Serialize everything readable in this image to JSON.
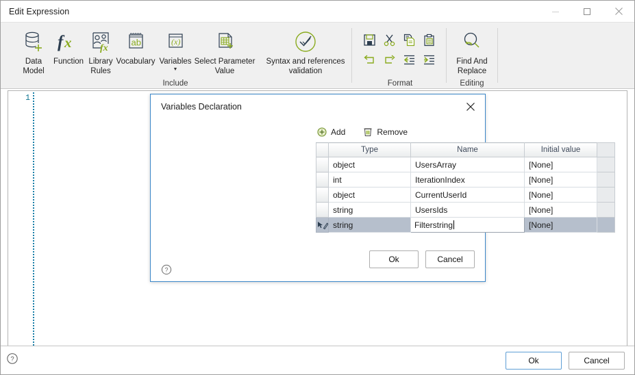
{
  "window": {
    "title": "Edit Expression",
    "minimize_label": "Minimize",
    "maximize_label": "Maximize",
    "close_label": "Close"
  },
  "ribbon": {
    "groups": [
      {
        "name": "include",
        "label": "Include",
        "items": [
          {
            "icon": "data-model-icon",
            "label": "Data\nModel",
            "caret": ""
          },
          {
            "icon": "function-fx-icon",
            "label": "Function",
            "caret": ""
          },
          {
            "icon": "library-rules-icon",
            "label": "Library\nRules",
            "caret": ""
          },
          {
            "icon": "vocabulary-icon",
            "label": "Vocabulary",
            "caret": ""
          },
          {
            "icon": "variables-icon",
            "label": "Variables",
            "caret": "▼"
          },
          {
            "icon": "select-parameter-value-icon",
            "label": "Select Parameter\nValue",
            "caret": ""
          }
        ]
      },
      {
        "name": "validation",
        "label": "",
        "items": [
          {
            "icon": "syntax-validation-check-icon",
            "label": "Syntax and references\nvalidation",
            "caret": ""
          }
        ]
      },
      {
        "name": "format",
        "label": "Format",
        "items": [
          {
            "icon": "save-icon",
            "label": "Save"
          },
          {
            "icon": "cut-scissors-icon",
            "label": "Cut"
          },
          {
            "icon": "copy-icon",
            "label": "Copy"
          },
          {
            "icon": "paste-clipboard-icon",
            "label": "Paste"
          },
          {
            "icon": "undo-arrow-icon",
            "label": "Undo"
          },
          {
            "icon": "redo-arrow-icon",
            "label": "Redo"
          },
          {
            "icon": "outdent-icon",
            "label": "Outdent"
          },
          {
            "icon": "indent-icon",
            "label": "Indent"
          }
        ]
      },
      {
        "name": "editing",
        "label": "Editing",
        "items": [
          {
            "icon": "find-and-replace-icon",
            "label": "Find And\nReplace",
            "caret": ""
          }
        ]
      }
    ]
  },
  "editor": {
    "line_numbers": [
      "1"
    ],
    "content": ""
  },
  "footer": {
    "help_icon": "help-question-icon",
    "ok_label": "Ok",
    "cancel_label": "Cancel"
  },
  "dialog": {
    "title": "Variables Declaration",
    "close_icon": "close-icon",
    "add_label": "Add",
    "add_icon": "plus-circle-icon",
    "remove_label": "Remove",
    "remove_icon": "trash-icon",
    "columns": [
      "Type",
      "Name",
      "Initial value"
    ],
    "rows": [
      {
        "type": "object",
        "name": "UsersArray",
        "initial": "[None]",
        "selected": false,
        "editing": false
      },
      {
        "type": "int",
        "name": "IterationIndex",
        "initial": "[None]",
        "selected": false,
        "editing": false
      },
      {
        "type": "object",
        "name": "CurrentUserId",
        "initial": "[None]",
        "selected": false,
        "editing": false
      },
      {
        "type": "string",
        "name": "UsersIds",
        "initial": "[None]",
        "selected": false,
        "editing": false
      },
      {
        "type": "string",
        "name": "Filterstring",
        "initial": "[None]",
        "selected": true,
        "editing": true
      }
    ],
    "ok_label": "Ok",
    "cancel_label": "Cancel",
    "help_icon": "help-question-icon"
  },
  "colors": {
    "accent_green": "#8aab1f",
    "ink_navy": "#2d3e50",
    "dialog_border": "#3a86c8",
    "selection": "#b6bfcc",
    "linenumber": "#0e7490"
  }
}
